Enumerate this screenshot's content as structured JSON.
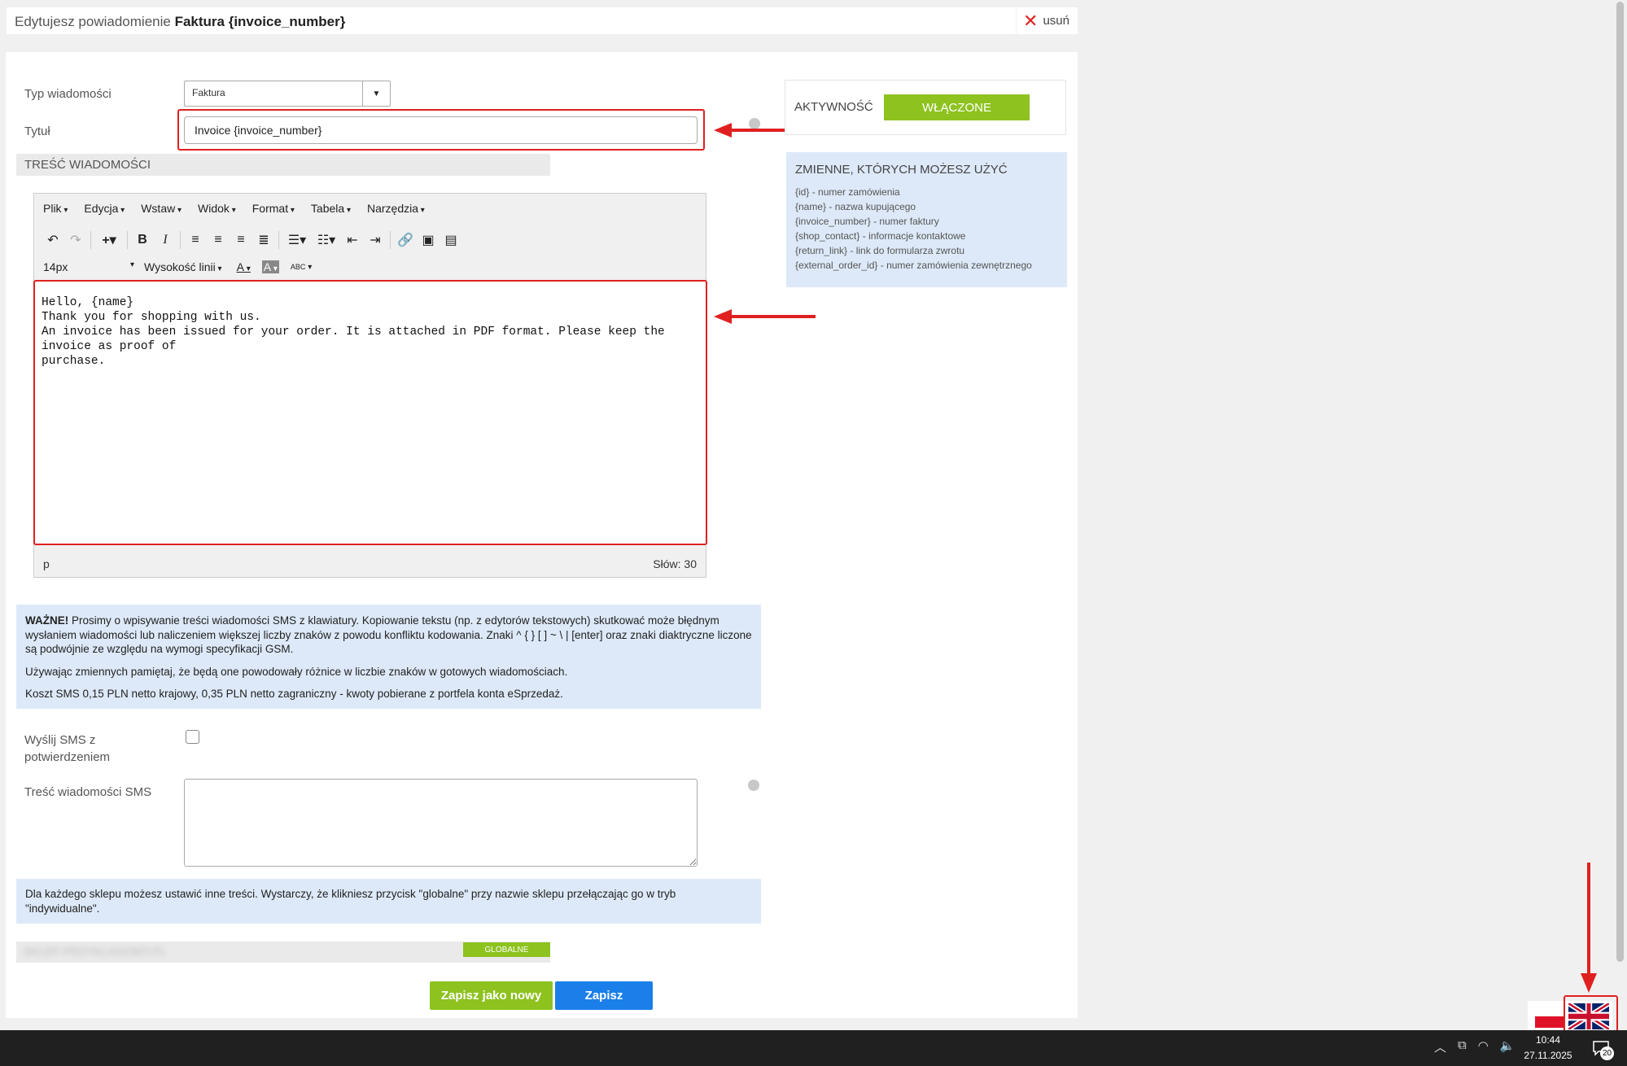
{
  "header": {
    "title_prefix": "Edytujesz powiadomienie",
    "title_name": "Faktura {invoice_number}",
    "delete_label": "usuń"
  },
  "form": {
    "type_label": "Typ wiadomości",
    "type_value": "Faktura",
    "title_label": "Tytuł",
    "title_value": "Invoice {invoice_number}",
    "content_section": "TREŚĆ WIADOMOŚCI",
    "sms_confirm_label_1": "Wyślij SMS z",
    "sms_confirm_label_2": "potwierdzeniem",
    "sms_content_label": "Treść wiadomości SMS"
  },
  "activity": {
    "label": "AKTYWNOŚĆ",
    "status": "WŁĄCZONE"
  },
  "variables": {
    "title": "ZMIENNE, KTÓRYCH MOŻESZ UŻYĆ",
    "items": [
      "{id} - numer zamówienia",
      "{name} - nazwa kupującego",
      "{invoice_number} - numer faktury",
      "{shop_contact} - informacje kontaktowe",
      "{return_link} - link do formularza zwrotu",
      "{external_order_id} - numer zamówienia zewnętrznego"
    ]
  },
  "editor": {
    "menu": [
      "Plik",
      "Edycja",
      "Wstaw",
      "Widok",
      "Format",
      "Tabela",
      "Narzędzia"
    ],
    "font_size": "14px",
    "line_height_label": "Wysokość linii",
    "spellcheck_label": "ABC",
    "content_lines": [
      "Hello, {name}",
      "Thank you for shopping with us.",
      "An invoice has been issued for your order. It is attached in PDF format. Please keep the invoice as proof of",
      "purchase."
    ],
    "status_path": "p",
    "word_count": "Słów: 30"
  },
  "info_sms": {
    "bold": "WAŻNE!",
    "p1": " Prosimy o wpisywanie treści wiadomości SMS z klawiatury. Kopiowanie tekstu (np. z edytorów tekstowych) skutkować może błędnym wysłaniem wiadomości lub naliczeniem większej liczby znaków z powodu konfliktu kodowania. Znaki ^ { } [ ] ~ \\ | [enter] oraz znaki diaktryczne liczone są podwójnie ze względu na wymogi specyfikacji GSM.",
    "p2": "Używając zmiennych pamiętaj, że będą one powodowały różnice w liczbie znaków w gotowych wiadomościach.",
    "p3": "Koszt SMS 0,15 PLN netto krajowy, 0,35 PLN netto zagraniczny - kwoty pobierane z portfela konta eSprzedaż."
  },
  "info_shops": {
    "text": "Dla każdego sklepu możesz ustawić inne treści. Wystarczy, że klikniesz przycisk \"globalne\" przy nazwie sklepu przełączając go w tryb \"indywidualne\"."
  },
  "shop": {
    "name": "SKLEP-PRZYKLADOWY.PL",
    "mode": "GLOBALNE"
  },
  "actions": {
    "save_new": "Zapisz jako nowy",
    "save": "Zapisz"
  },
  "taskbar": {
    "time": "10:44",
    "date": "27.11.2025",
    "notifications": "20"
  },
  "colors": {
    "accent_green": "#8dc21f",
    "accent_blue": "#1a7fe8",
    "info_bg": "#dde9f8",
    "highlight_red": "#e02020"
  }
}
